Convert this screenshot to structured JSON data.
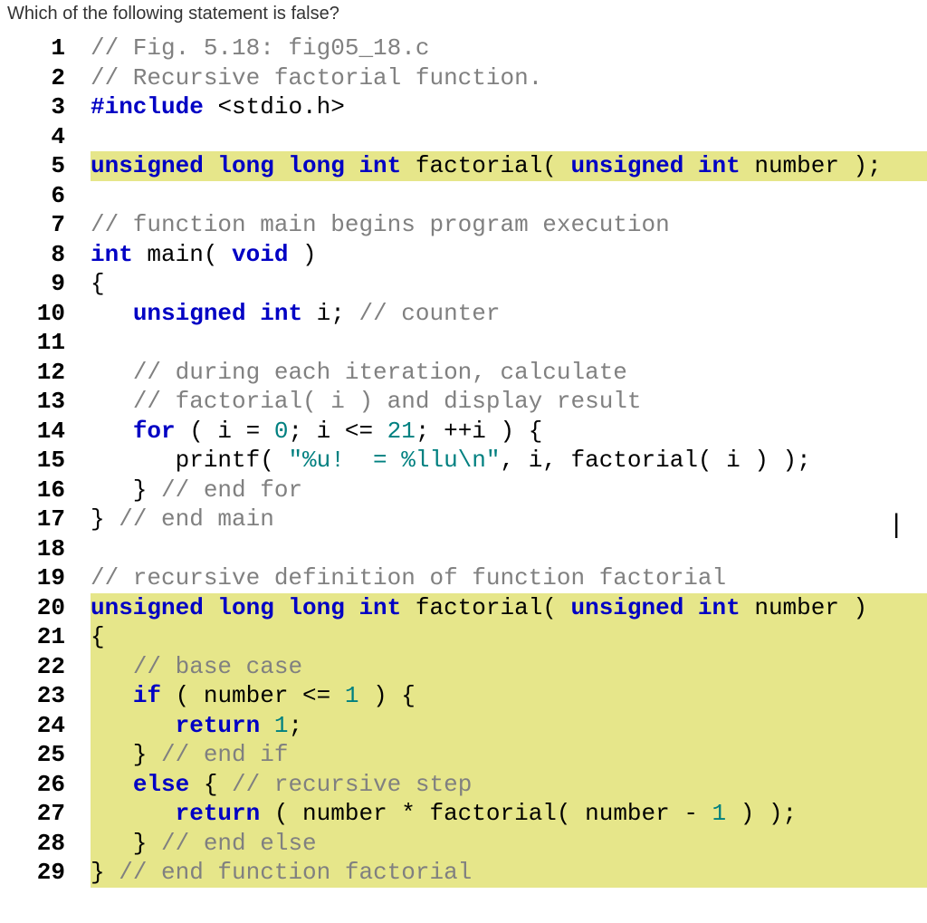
{
  "question": "Which of the following statement is false?",
  "code": [
    {
      "n": "1",
      "hl": false,
      "tokens": [
        {
          "c": "cmt",
          "t": "// Fig. 5.18: fig05_18.c"
        }
      ]
    },
    {
      "n": "2",
      "hl": false,
      "tokens": [
        {
          "c": "cmt",
          "t": "// Recursive factorial function."
        }
      ]
    },
    {
      "n": "3",
      "hl": false,
      "tokens": [
        {
          "c": "pp",
          "t": "#include "
        },
        {
          "c": "id",
          "t": "<stdio.h>"
        }
      ]
    },
    {
      "n": "4",
      "hl": false,
      "tokens": [
        {
          "c": "id",
          "t": ""
        }
      ]
    },
    {
      "n": "5",
      "hl": true,
      "tokens": [
        {
          "c": "kw",
          "t": "unsigned long long int"
        },
        {
          "c": "id",
          "t": " factorial( "
        },
        {
          "c": "kw",
          "t": "unsigned int"
        },
        {
          "c": "id",
          "t": " number );"
        }
      ]
    },
    {
      "n": "6",
      "hl": false,
      "tokens": [
        {
          "c": "id",
          "t": ""
        }
      ]
    },
    {
      "n": "7",
      "hl": false,
      "tokens": [
        {
          "c": "cmt",
          "t": "// function main begins program execution"
        }
      ]
    },
    {
      "n": "8",
      "hl": false,
      "tokens": [
        {
          "c": "kw",
          "t": "int"
        },
        {
          "c": "id",
          "t": " main( "
        },
        {
          "c": "kw",
          "t": "void"
        },
        {
          "c": "id",
          "t": " )"
        }
      ]
    },
    {
      "n": "9",
      "hl": false,
      "tokens": [
        {
          "c": "id",
          "t": "{"
        }
      ]
    },
    {
      "n": "10",
      "hl": false,
      "tokens": [
        {
          "c": "id",
          "t": "   "
        },
        {
          "c": "kw",
          "t": "unsigned int"
        },
        {
          "c": "id",
          "t": " i; "
        },
        {
          "c": "cmt",
          "t": "// counter"
        }
      ]
    },
    {
      "n": "11",
      "hl": false,
      "tokens": [
        {
          "c": "id",
          "t": ""
        }
      ]
    },
    {
      "n": "12",
      "hl": false,
      "tokens": [
        {
          "c": "id",
          "t": "   "
        },
        {
          "c": "cmt",
          "t": "// during each iteration, calculate"
        }
      ]
    },
    {
      "n": "13",
      "hl": false,
      "tokens": [
        {
          "c": "id",
          "t": "   "
        },
        {
          "c": "cmt",
          "t": "// factorial( i ) and display result"
        }
      ]
    },
    {
      "n": "14",
      "hl": false,
      "tokens": [
        {
          "c": "id",
          "t": "   "
        },
        {
          "c": "kw",
          "t": "for"
        },
        {
          "c": "id",
          "t": " ( i = "
        },
        {
          "c": "num",
          "t": "0"
        },
        {
          "c": "id",
          "t": "; i <= "
        },
        {
          "c": "num",
          "t": "21"
        },
        {
          "c": "id",
          "t": "; ++i ) {"
        }
      ]
    },
    {
      "n": "15",
      "hl": false,
      "tokens": [
        {
          "c": "id",
          "t": "      printf( "
        },
        {
          "c": "str",
          "t": "\"%u!  = %llu\\n\""
        },
        {
          "c": "id",
          "t": ", i, factorial( i ) );"
        }
      ]
    },
    {
      "n": "16",
      "hl": false,
      "tokens": [
        {
          "c": "id",
          "t": "   } "
        },
        {
          "c": "cmt",
          "t": "// end for"
        }
      ]
    },
    {
      "n": "17",
      "hl": false,
      "tokens": [
        {
          "c": "id",
          "t": "} "
        },
        {
          "c": "cmt",
          "t": "// end main"
        }
      ]
    },
    {
      "n": "18",
      "hl": false,
      "tokens": [
        {
          "c": "id",
          "t": ""
        }
      ]
    },
    {
      "n": "19",
      "hl": false,
      "tokens": [
        {
          "c": "cmt",
          "t": "// recursive definition of function factorial"
        }
      ]
    },
    {
      "n": "20",
      "hl": true,
      "tokens": [
        {
          "c": "kw",
          "t": "unsigned long long int"
        },
        {
          "c": "id",
          "t": " factorial( "
        },
        {
          "c": "kw",
          "t": "unsigned int"
        },
        {
          "c": "id",
          "t": " number )"
        }
      ]
    },
    {
      "n": "21",
      "hl": true,
      "tokens": [
        {
          "c": "id",
          "t": "{"
        }
      ]
    },
    {
      "n": "22",
      "hl": true,
      "tokens": [
        {
          "c": "id",
          "t": "   "
        },
        {
          "c": "cmt",
          "t": "// base case"
        }
      ]
    },
    {
      "n": "23",
      "hl": true,
      "tokens": [
        {
          "c": "id",
          "t": "   "
        },
        {
          "c": "kw",
          "t": "if"
        },
        {
          "c": "id",
          "t": " ( number <= "
        },
        {
          "c": "num",
          "t": "1"
        },
        {
          "c": "id",
          "t": " ) {"
        }
      ]
    },
    {
      "n": "24",
      "hl": true,
      "tokens": [
        {
          "c": "id",
          "t": "      "
        },
        {
          "c": "kw",
          "t": "return"
        },
        {
          "c": "id",
          "t": " "
        },
        {
          "c": "num",
          "t": "1"
        },
        {
          "c": "id",
          "t": ";"
        }
      ]
    },
    {
      "n": "25",
      "hl": true,
      "tokens": [
        {
          "c": "id",
          "t": "   } "
        },
        {
          "c": "cmt",
          "t": "// end if"
        }
      ]
    },
    {
      "n": "26",
      "hl": true,
      "tokens": [
        {
          "c": "id",
          "t": "   "
        },
        {
          "c": "kw",
          "t": "else"
        },
        {
          "c": "id",
          "t": " { "
        },
        {
          "c": "cmt",
          "t": "// recursive step"
        }
      ]
    },
    {
      "n": "27",
      "hl": true,
      "tokens": [
        {
          "c": "id",
          "t": "      "
        },
        {
          "c": "kw",
          "t": "return"
        },
        {
          "c": "id",
          "t": " ( number * factorial( number - "
        },
        {
          "c": "num",
          "t": "1"
        },
        {
          "c": "id",
          "t": " ) );"
        }
      ]
    },
    {
      "n": "28",
      "hl": true,
      "tokens": [
        {
          "c": "id",
          "t": "   } "
        },
        {
          "c": "cmt",
          "t": "// end else"
        }
      ]
    },
    {
      "n": "29",
      "hl": true,
      "tokens": [
        {
          "c": "id",
          "t": "} "
        },
        {
          "c": "cmt",
          "t": "// end function factorial"
        }
      ]
    }
  ]
}
